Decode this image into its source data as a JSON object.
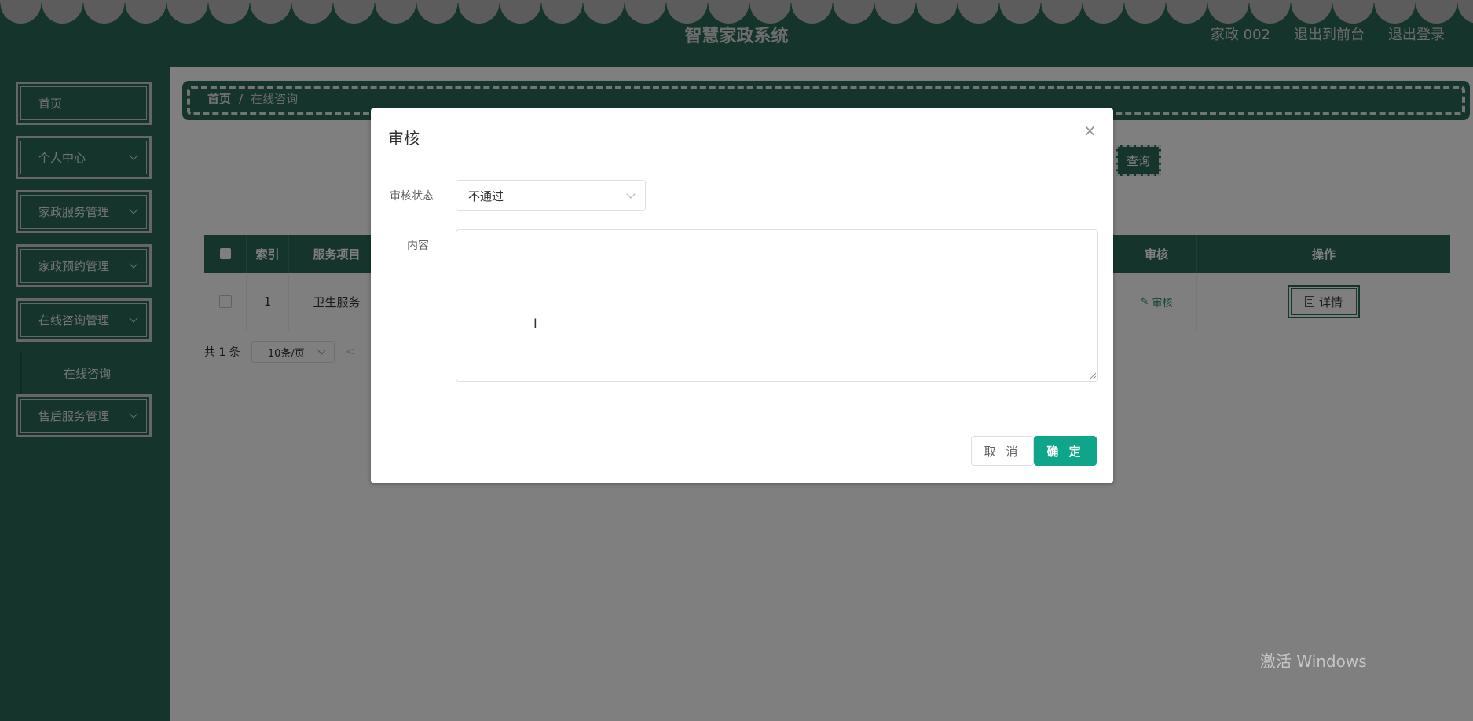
{
  "header": {
    "title": "智慧家政系统",
    "user": "家政 002",
    "to_front": "退出到前台",
    "logout": "退出登录"
  },
  "sidebar": {
    "items": [
      {
        "label": "首页"
      },
      {
        "label": "个人中心"
      },
      {
        "label": "家政服务管理"
      },
      {
        "label": "家政预约管理"
      },
      {
        "label": "在线咨询管理"
      },
      {
        "label": "售后服务管理"
      }
    ],
    "sub_item": "在线咨询"
  },
  "breadcrumb": {
    "home": "首页",
    "separator": "/",
    "current": "在线咨询"
  },
  "toolbar": {
    "query_label": "查询"
  },
  "table": {
    "headers": {
      "index": "索引",
      "service": "服务项目",
      "audit": "审核",
      "action": "操作"
    },
    "rows": [
      {
        "index": "1",
        "service": "卫生服务",
        "audit": "审核",
        "action": "详情"
      }
    ]
  },
  "pagination": {
    "total": "共 1 条",
    "page_size": "10条/页",
    "prev": "<"
  },
  "modal": {
    "title": "审核",
    "close": "×",
    "status_label": "审核状态",
    "status_value": "不通过",
    "content_label": "内容",
    "content_value": "",
    "cancel": "取 消",
    "confirm": "确 定"
  },
  "watermark": "激活 Windows",
  "colors": {
    "primary": "#2a6a58",
    "confirm": "#0fa58a",
    "overlay": "rgba(0,0,0,0.5)"
  }
}
